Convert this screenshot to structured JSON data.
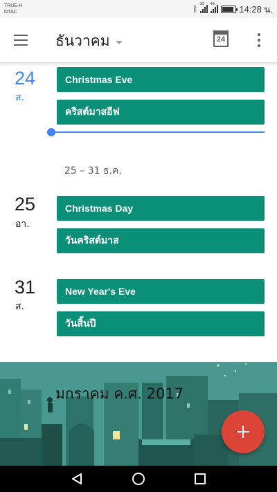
{
  "status_bar": {
    "carrier_line1": "TRUE-H",
    "carrier_line2": "DTAC",
    "network1": "3G",
    "network2": "4G",
    "time": "14:28 น."
  },
  "app_bar": {
    "month": "ธันวาคม",
    "today_date": "24"
  },
  "days": [
    {
      "day": "24",
      "weekday": "ส.",
      "is_today": true,
      "events": [
        "Christmas Eve",
        "คริสต์มาสอีฟ"
      ]
    },
    {
      "day": "25",
      "weekday": "อา.",
      "is_today": false,
      "events": [
        "Christmas Day",
        "วันคริสต์มาส"
      ]
    },
    {
      "day": "31",
      "weekday": "ส.",
      "is_today": false,
      "events": [
        "New Year's Eve",
        "วันสิ้นปี"
      ]
    }
  ],
  "week_label": "25 – 31 ธ.ค.",
  "month_banner": {
    "title": "มกราคม ค.ศ. 2017"
  },
  "colors": {
    "event": "#0b8f78",
    "today": "#4285f4",
    "fab": "#db4437",
    "banner": "#3e8c84"
  },
  "icons": {
    "menu": "menu-icon",
    "dropdown": "dropdown-caret-icon",
    "today": "calendar-today-icon",
    "overflow": "more-vert-icon",
    "fab": "plus-icon"
  }
}
